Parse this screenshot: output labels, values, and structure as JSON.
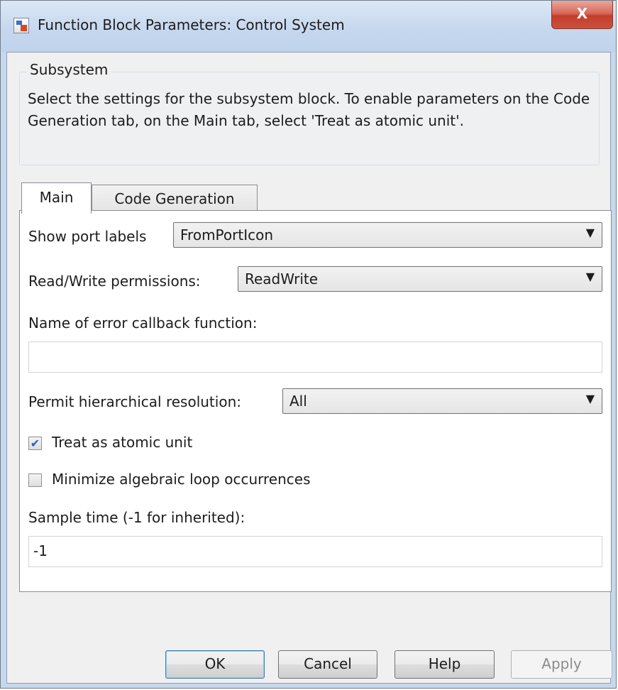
{
  "window": {
    "title": "Function Block Parameters: Control System",
    "close_glyph": "X",
    "icon": "simulink-block-icon"
  },
  "group": {
    "label": "Subsystem",
    "description": "Select the settings for the subsystem block. To enable parameters on the Code Generation tab, on the Main tab, select 'Treat as atomic unit'."
  },
  "tabs": [
    {
      "label": "Main",
      "selected": true
    },
    {
      "label": "Code Generation",
      "selected": false
    }
  ],
  "fields": {
    "show_port_labels": {
      "label": "Show port labels",
      "value": "FromPortIcon"
    },
    "read_write_permissions": {
      "label": "Read/Write permissions:",
      "value": "ReadWrite"
    },
    "error_callback": {
      "label": "Name of error callback function:",
      "value": ""
    },
    "hierarchical_resolution": {
      "label": "Permit hierarchical resolution:",
      "value": "All"
    },
    "treat_atomic": {
      "label": "Treat as atomic unit",
      "checked": true,
      "glyph": "✔"
    },
    "minimize_loop": {
      "label": "Minimize algebraic loop occurrences",
      "checked": false,
      "glyph": ""
    },
    "sample_time": {
      "label": "Sample time (-1 for inherited):",
      "value": "-1"
    }
  },
  "dropdown_arrow": "▼",
  "buttons": {
    "ok": "OK",
    "cancel": "Cancel",
    "help": "Help",
    "apply": "Apply"
  },
  "colors": {
    "frame": "#c7d8ed",
    "close": "#c43d2b",
    "check": "#2a5fbf"
  }
}
